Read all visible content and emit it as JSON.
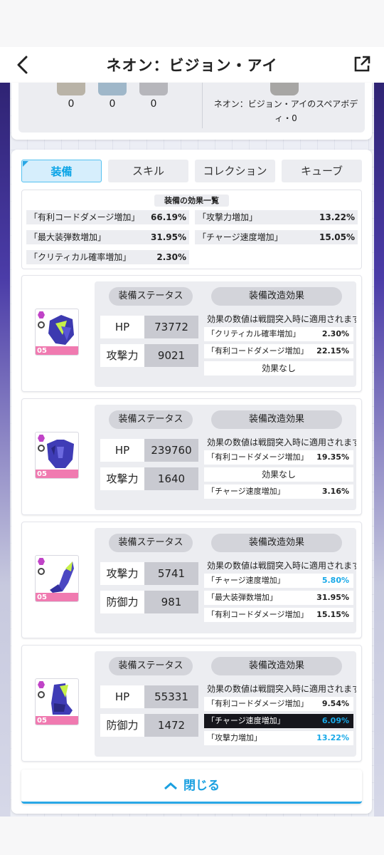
{
  "header": {
    "title": "ネオン：ビジョン・アイ"
  },
  "summary": {
    "counts": [
      "0",
      "0",
      "0"
    ],
    "spare_text": "ネオン：ビジョン・アイのスペアボディ・0"
  },
  "tabs": [
    "装備",
    "スキル",
    "コレクション",
    "キューブ"
  ],
  "effects": {
    "title": "装備の効果一覧",
    "items": [
      {
        "label": "「有利コードダメージ増加」",
        "value": "66.19%"
      },
      {
        "label": "「攻撃力増加」",
        "value": "13.22%"
      },
      {
        "label": "「最大装弾数増加」",
        "value": "31.95%"
      },
      {
        "label": "「チャージ速度増加」",
        "value": "15.05%"
      },
      {
        "label": "「クリティカル確率増加」",
        "value": "2.30%"
      }
    ]
  },
  "equip": [
    {
      "level": "05",
      "status_label": "装備ステータス",
      "mod_label": "装備改造効果",
      "stats": [
        {
          "name": "HP",
          "value": "73772"
        },
        {
          "name": "攻撃力",
          "value": "9021"
        }
      ],
      "mod_note": "効果の数値は戦闘突入時に適用されます",
      "mods": [
        {
          "label": "「クリティカル確率増加」",
          "value": "2.30%"
        },
        {
          "label": "「有利コードダメージ増加」",
          "value": "22.15%"
        },
        {
          "label": "効果なし",
          "value": ""
        }
      ]
    },
    {
      "level": "05",
      "status_label": "装備ステータス",
      "mod_label": "装備改造効果",
      "stats": [
        {
          "name": "HP",
          "value": "239760"
        },
        {
          "name": "攻撃力",
          "value": "1640"
        }
      ],
      "mod_note": "効果の数値は戦闘突入時に適用されます",
      "mods": [
        {
          "label": "「有利コードダメージ増加」",
          "value": "19.35%"
        },
        {
          "label": "効果なし",
          "value": ""
        },
        {
          "label": "「チャージ速度増加」",
          "value": "3.16%"
        }
      ]
    },
    {
      "level": "05",
      "status_label": "装備ステータス",
      "mod_label": "装備改造効果",
      "stats": [
        {
          "name": "攻撃力",
          "value": "5741"
        },
        {
          "name": "防御力",
          "value": "981"
        }
      ],
      "mod_note": "効果の数値は戦闘突入時に適用されます",
      "mods": [
        {
          "label": "「チャージ速度増加」",
          "value": "5.80%"
        },
        {
          "label": "「最大装弾数増加」",
          "value": "31.95%"
        },
        {
          "label": "「有利コードダメージ増加」",
          "value": "15.15%"
        }
      ]
    },
    {
      "level": "05",
      "status_label": "装備ステータス",
      "mod_label": "装備改造効果",
      "stats": [
        {
          "name": "HP",
          "value": "55331"
        },
        {
          "name": "防御力",
          "value": "1472"
        }
      ],
      "mod_note": "効果の数値は戦闘突入時に適用されます",
      "mods": [
        {
          "label": "「有利コードダメージ増加」",
          "value": "9.54%"
        },
        {
          "label": "「チャージ速度増加」",
          "value": "6.09%"
        },
        {
          "label": "「攻撃力増加」",
          "value": "13.22%"
        }
      ]
    }
  ],
  "close_label": "閉じる",
  "colors": {
    "accent": "#1aa0e0",
    "highlight_value": "#18a9e8",
    "pink_band": "#f07ab0"
  }
}
